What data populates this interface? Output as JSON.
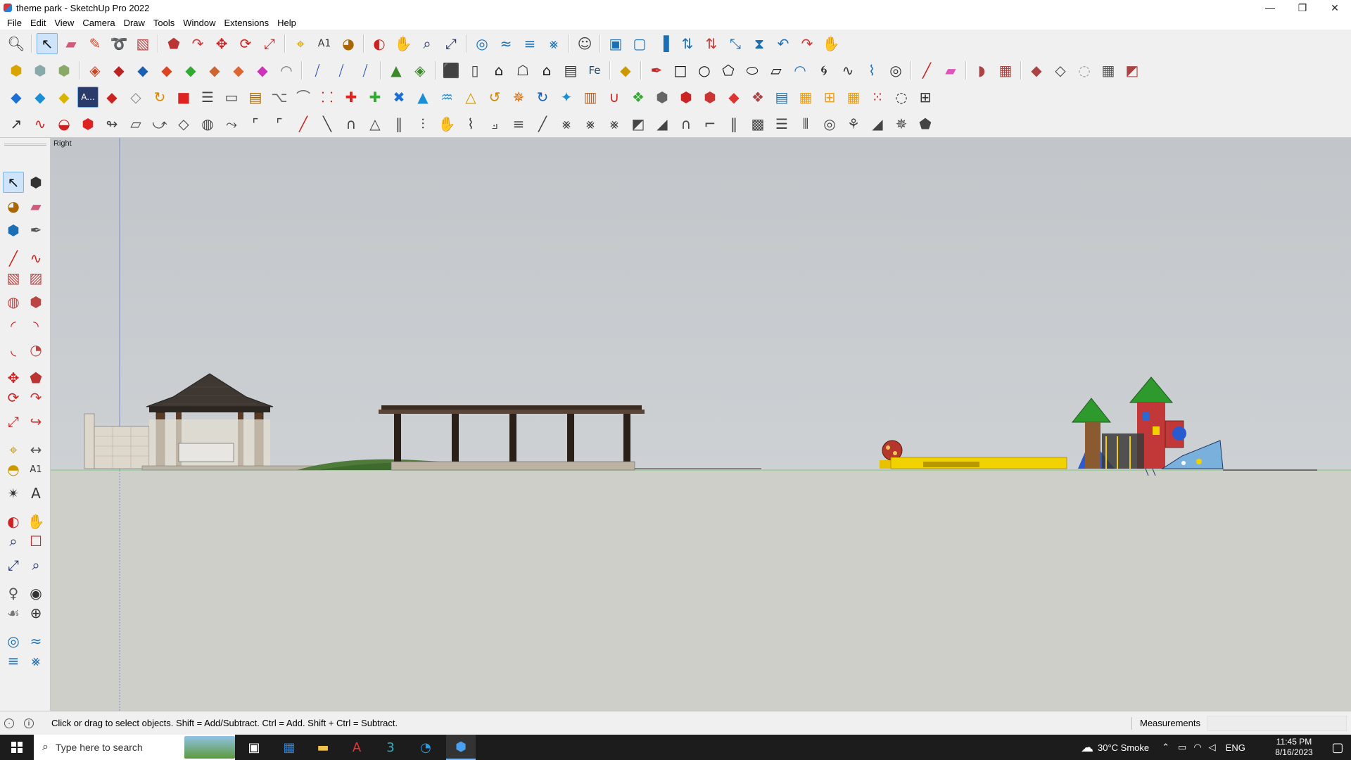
{
  "window": {
    "title": "theme park - SketchUp Pro 2022",
    "minimize": "—",
    "restore": "❐",
    "close": "✕"
  },
  "menu": [
    "File",
    "Edit",
    "View",
    "Camera",
    "Draw",
    "Tools",
    "Window",
    "Extensions",
    "Help"
  ],
  "viewport": {
    "view_label": "Right"
  },
  "status": {
    "message": "Click or drag to select objects. Shift = Add/Subtract. Ctrl = Add. Shift + Ctrl = Subtract.",
    "measurements_label": "Measurements",
    "measurements_value": ""
  },
  "taskbar": {
    "search_placeholder": "Type here to search",
    "weather": "30°C Smoke",
    "language": "ENG",
    "time": "11:45 PM",
    "date": "8/16/2023"
  },
  "colors": {
    "sky": "#c4c8cc",
    "ground": "#cfcfca",
    "axis_green": "#7fc97f",
    "axis_blue": "#7f8fd0",
    "taskbar": "#1c1c1c"
  }
}
